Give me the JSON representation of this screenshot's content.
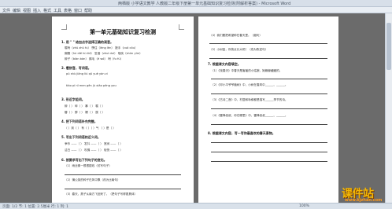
{
  "window": {
    "title": "两栖版 小学语文教学 人教版二年级下册第一单元基础知识复习检测(附解析答案) - Microsoft Word"
  },
  "menu": [
    "文件",
    "编辑",
    "视图",
    "插入",
    "格式",
    "工具",
    "表格",
    "窗口",
    "帮助"
  ],
  "left_page": {
    "title": "第一单元基础知识复习检测",
    "q1": "1. 用 \" \" 给加点字选择正确的读音。",
    "q1_r1": "嘱咐（zhǔ zhǔ fu）   愣住（lèng lèn）   搓手（cuō cōu）",
    "q1_r2": "蝴蝶（hú dié hú tié）   坠落（zhuì duì）   吸吮（shǔn yǔn）",
    "q1_r3": "辫子（biàn bàn）   鹅毛（é wó）   咐（fu fù）",
    "q2": "2. 看拼音，写词语。",
    "q2_r1": "pǔ shù     jiāng liú     qū yuè     yàn zi",
    "q2_r2": "tiáo pí     nǐ men     gēn jù     xiǎo péng you",
    "q3": "3. 形近字组词。",
    "q3_r1": "辫（     ）   碎（     ）   暴（     ）   嘱（     ）",
    "q3_r2": "瓣（     ）   醉（     ）   爆（     ）   属（     ）",
    "q4": "4. 把下列词语补充完整。",
    "q4_r1": "（  ）到（  ）   有（  ）（  ）气   （  ）是（  ）",
    "q5": "5. 写出下列词语的近义词。",
    "q5_r1": "争吵 ——（    ）   发抖 ——（    ）   宽阔 ——（    ）",
    "q5_r2": "洁白 ——（    ）   吹拂 ——（    ）   轻快 ——（    ）",
    "q6": "6. 按要求写出下列句子的变化。",
    "q6_s1": "（1）雨丝像一根根银线（仿写句子）",
    "q6_s2": "（2）蒲公英的种子在风中飘（改为比喻句）",
    "q6_s3": "（3）春天，燕子从南方飞回来了。（把句子写得更具体）"
  },
  "right_page": {
    "r1": "（4）我们要把希望种在春天里。（缩句）",
    "r2": "（5）小树苗，你快点长大吧！（改为陈述句）",
    "r3": "7. 根据课文内容填空。",
    "r4": "（1）《找春天》中春天是害羞的小姑娘，她躲躲藏藏的。",
    "r5": "（2）《邓小平爷爷植树》中，小树在春风中______、______。",
    "r6": "（3）《古诗二首》中，村居和咏柳都是描写______季节的诗。",
    "r7": "（4）《雷锋叔叔，你在哪里》中，雷锋叔叔______、______。",
    "r8": "8. 根据课文内容，写一写你最喜欢的春天景物。"
  },
  "status": {
    "text": "页面: 1/2  节: 1  位置: 2.5厘米  行: 1  列: 1",
    "zoom": "100%"
  },
  "watermark": {
    "logo": "课件站",
    "url": "www.kjzhan.com"
  },
  "colors": {
    "workspace": "#6b6b6b",
    "logo": "#f2b705",
    "url": "#ff9a1a"
  }
}
